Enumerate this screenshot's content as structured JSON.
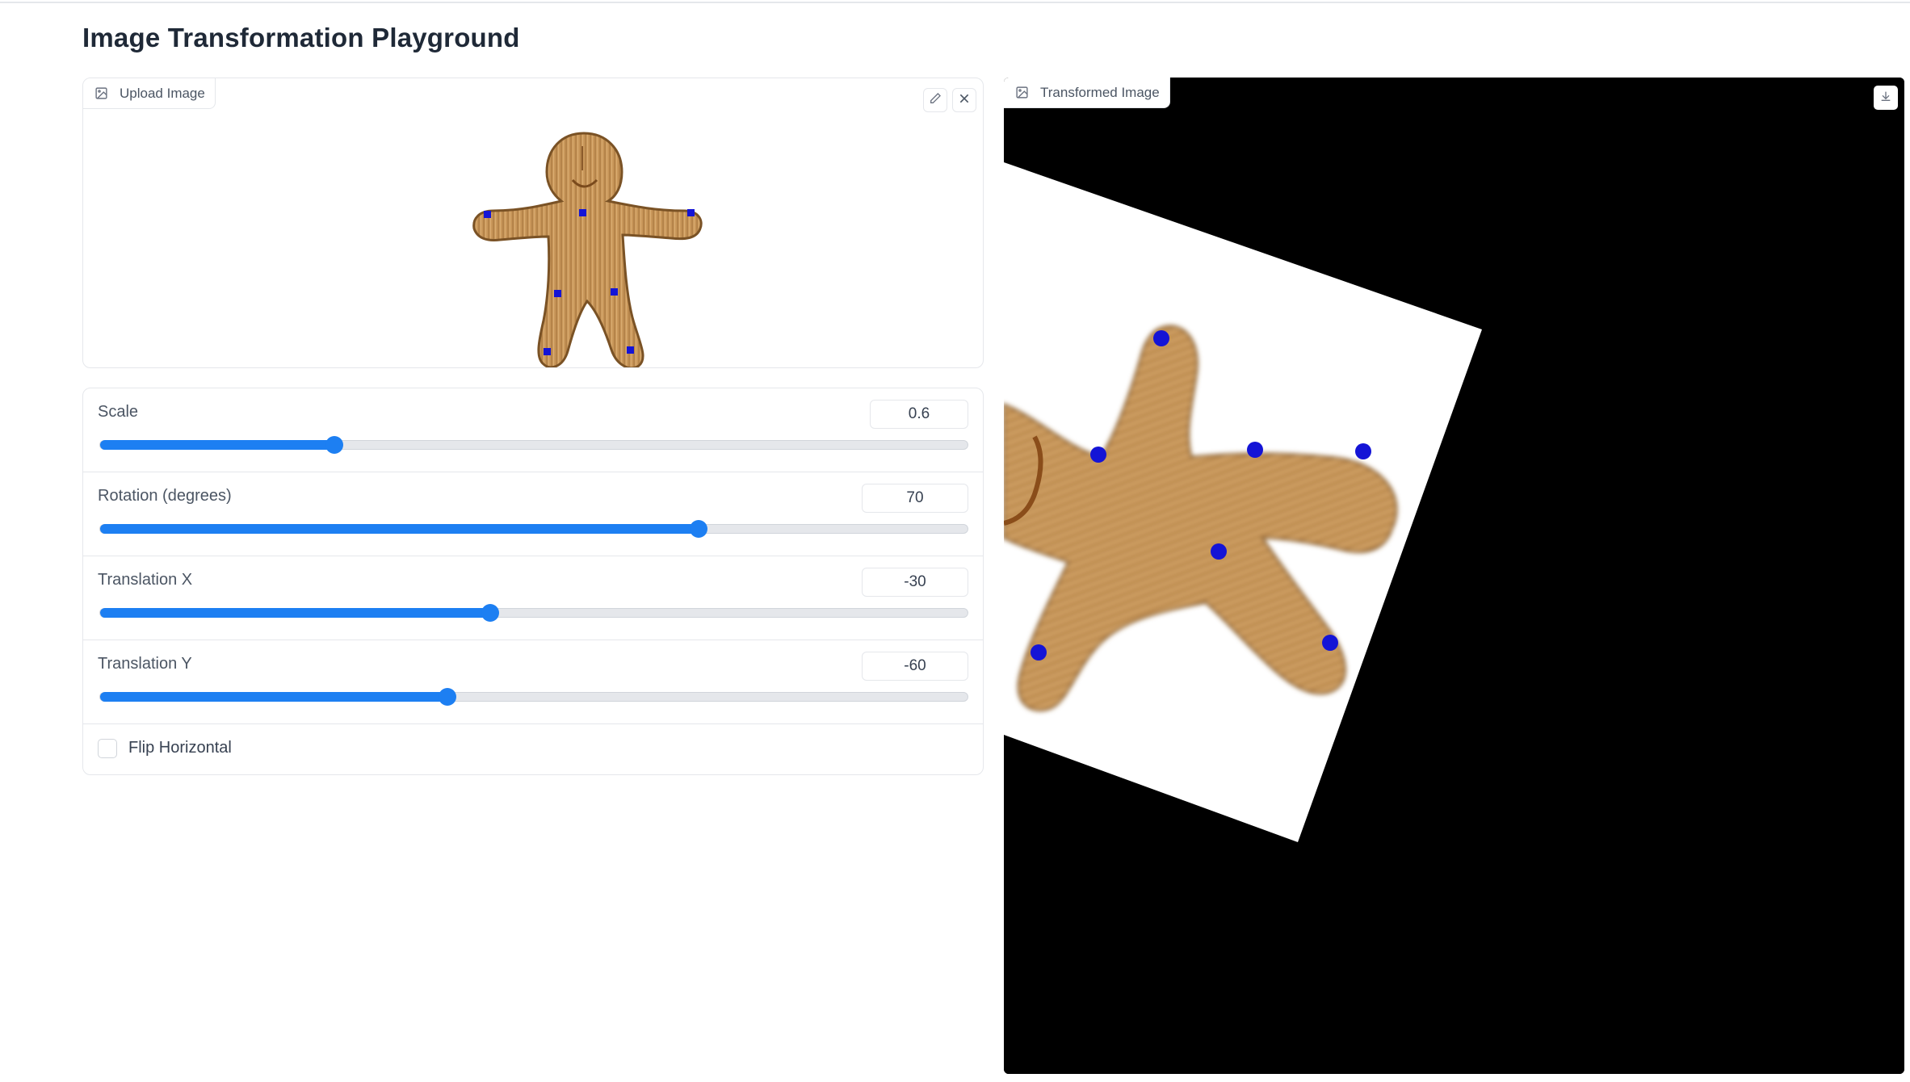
{
  "page_title": "Image Transformation Playground",
  "upload": {
    "label": "Upload Image",
    "label_icon": "image-icon",
    "edit_icon": "pencil-icon",
    "clear_icon": "close-icon"
  },
  "controls": {
    "sliders": [
      {
        "label": "Scale",
        "value": "0.6",
        "fraction": 0.27
      },
      {
        "label": "Rotation (degrees)",
        "value": "70",
        "fraction": 0.69
      },
      {
        "label": "Translation X",
        "value": "-30",
        "fraction": 0.45
      },
      {
        "label": "Translation Y",
        "value": "-60",
        "fraction": 0.4
      }
    ],
    "flip_label": "Flip Horizontal",
    "flip_checked": false
  },
  "output": {
    "label": "Transformed Image",
    "label_icon": "image-icon",
    "download_icon": "download-icon"
  },
  "colors": {
    "accent": "#1d7ff2",
    "keypoint": "#1414d6",
    "wood": "#c9975a",
    "output_background": "#000000"
  }
}
